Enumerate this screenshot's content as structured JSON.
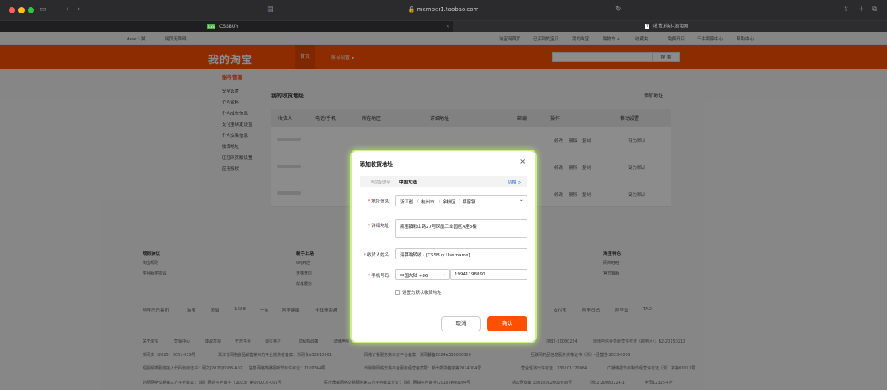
{
  "browser": {
    "url": "member1.taobao.com",
    "tabs": [
      {
        "title": "CSSBUY",
        "favicon": "CSS"
      },
      {
        "title": "收货地址-淘宝网",
        "favicon": "T"
      }
    ]
  },
  "topnav": {
    "left": [
      "dear丶猫...",
      "网页无障碍"
    ],
    "right": [
      "淘宝网首页",
      "已买到的宝贝",
      "我的淘宝",
      "购物车 4",
      "收藏夹",
      "免费开店",
      "千牛卖家中心",
      "帮助中心"
    ]
  },
  "header": {
    "logo": "我的淘宝",
    "nav": [
      "首页",
      "账号设置"
    ],
    "search_button": "搜 索"
  },
  "sidebar": {
    "title": "账号管理",
    "items": [
      "安全设置",
      "个人资料",
      "个人成长信息",
      "支付宝绑定设置",
      "个人交易信息",
      "收货地址",
      "旺旺网页版设置",
      "应用授权"
    ]
  },
  "main": {
    "title": "我的收货地址",
    "add_link": "添加地址",
    "columns": [
      "收货人",
      "电话/手机",
      "所在地区",
      "详细地址",
      "邮编",
      "操作",
      "移动设置"
    ],
    "row_actions": [
      "修改",
      "删除",
      "复制"
    ],
    "row_set_default": "设为默认"
  },
  "footer": {
    "columns": [
      {
        "title": "规则协议",
        "items": [
          "淘宝规则",
          "平台服务协议"
        ]
      },
      {
        "title": "新手上路",
        "items": [
          "0元开店",
          "天猫开店",
          "帮家服务"
        ]
      },
      {
        "title": "淘宝特色",
        "items": [
          "网商旺旺",
          "官方客服"
        ]
      }
    ],
    "brands": [
      "阿里巴巴集团",
      "淘宝",
      "天猫",
      "1688",
      "一淘",
      "阿里健康",
      "全球速卖通",
      "支付宝",
      "阿里妈妈",
      "阿里云",
      "TAO"
    ],
    "legal_lines": [
      [
        "关于淘宝",
        "营销中心",
        "廉政举报",
        "开放平台",
        "诚征英才",
        "隐私权政策",
        "法律声明",
        "浙B2-20080224",
        "增值电信业务经营许可证（跨地区）：B2-20150210"
      ],
      [
        "浙网文（2025）0051-019号",
        "浙江省网络食品销售第三方平台提供者备案：浙网食A33010001",
        "网络订餐服务第三方平台备案：浙网餐备2024A330000020",
        "互联网药品信息服务资格证书（浙）-经营性-2023-0009"
      ],
      [
        "短视频类服务接入代码使用证书：网文[2020]0386-A02",
        "信息网络传播视听节目许可证：1109364号",
        "出版物网络交易平台服务经营备案号：新出发浙备字第2024004号",
        "营业性演出许可证：330101120064",
        "广播电视节目制作经营许可证（浙）字第01012号"
      ],
      [
        "药品网络交易第三方平台备案：（浙）网药平台备字（2023）第000016-001号",
        "医疗器械网络交易服务第三方平台备案凭证：（浙）网械平台备字[2018]第00004号",
        "浙公网安备 33010002000078号",
        "浙B2-20080224-1",
        "全国12315平台"
      ]
    ]
  },
  "modal": {
    "title": "添加收货地址",
    "region_label": "当前配送至",
    "region_value": "中国大陆",
    "switch_label": "切换 >",
    "address_info_label": "地址信息:",
    "address_parts": [
      "浙江省",
      "杭州市",
      "余杭区",
      "瓶窑镇"
    ],
    "detail_label": "详细地址:",
    "detail_value": "瓶窑镇彩山路27号凤凰工业园区A座3楼",
    "name_label": "收货人姓名:",
    "name_value": "海慕购转收 - [CSSBuy Username]",
    "phone_label": "手机号码:",
    "country_code": "中国大陆 +86",
    "phone_value": "19941198890",
    "default_checkbox_label": "设置为默认收货地址",
    "default_checked": false,
    "cancel_button": "取消",
    "confirm_button": "确认",
    "accent_color": "#ff5000"
  }
}
